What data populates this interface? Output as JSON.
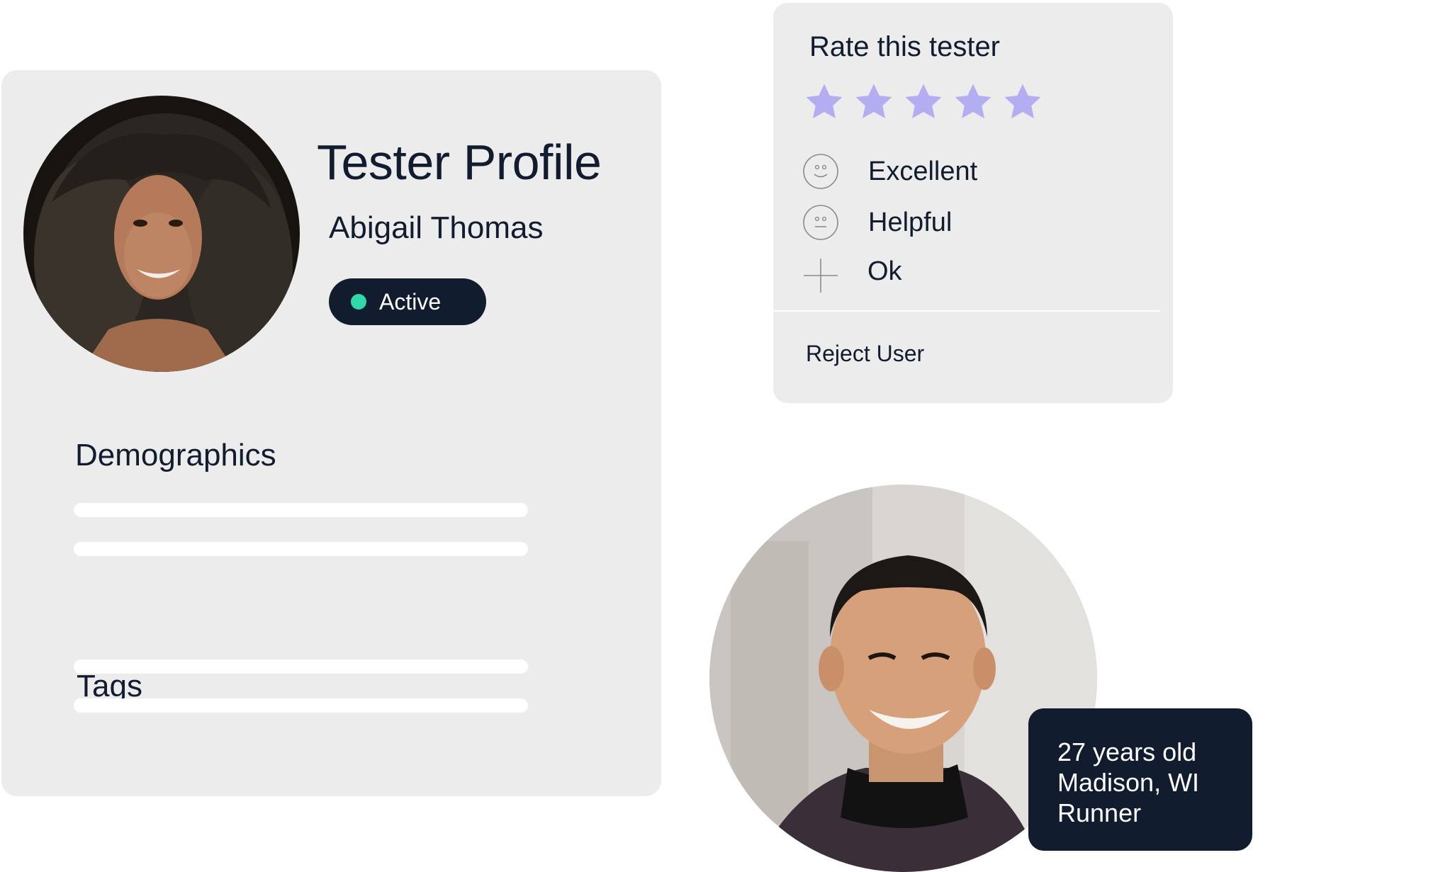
{
  "profile": {
    "title": "Tester Profile",
    "name": "Abigail Thomas",
    "status": {
      "label": "Active",
      "dot_color": "#2ed8a8"
    },
    "sections": [
      {
        "heading": "Demographics"
      },
      {
        "heading": "Tags"
      }
    ]
  },
  "rating": {
    "title": "Rate this tester",
    "stars_total": 5,
    "stars_filled": 5,
    "star_color": "#b3aef2",
    "options": [
      {
        "label": "Excellent",
        "icon": "smile-face-icon"
      },
      {
        "label": "Helpful",
        "icon": "neutral-face-icon"
      },
      {
        "label": "Ok",
        "icon": "plus-icon"
      }
    ],
    "reject_label": "Reject User"
  },
  "second_tester": {
    "lines": [
      "27 years old",
      "Madison, WI",
      "Runner"
    ]
  },
  "colors": {
    "card_background": "#ececec",
    "dark_navy": "#111d2e",
    "placeholder_line": "#ffffff"
  }
}
